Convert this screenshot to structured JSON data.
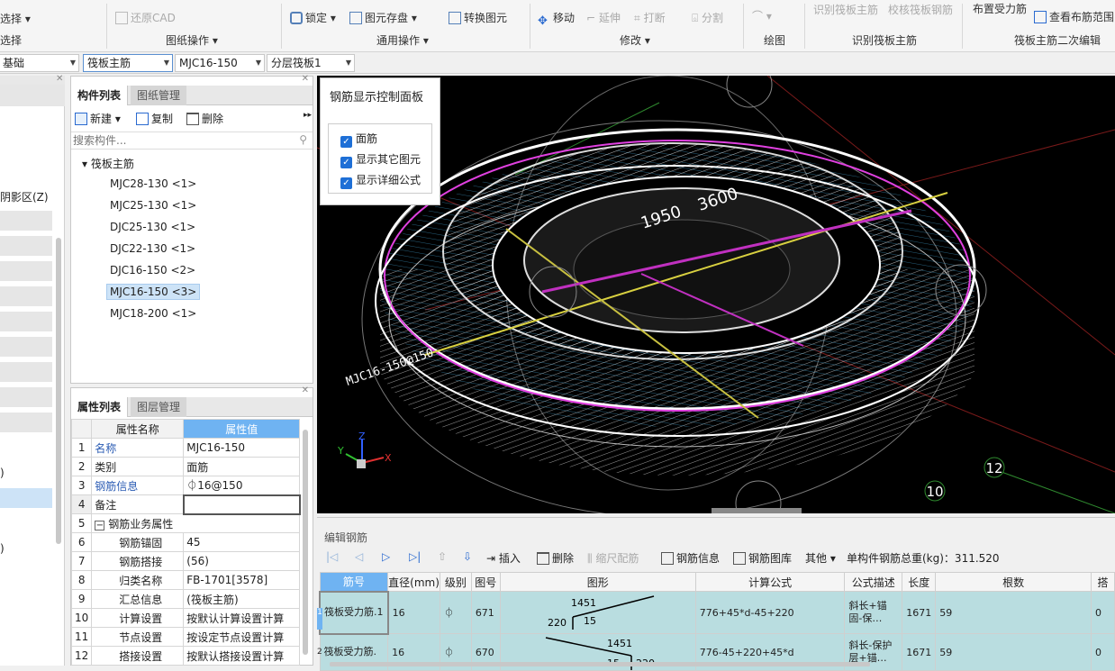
{
  "ribbon": {
    "row1": {
      "select": "选择",
      "restore_cad": "还原CAD",
      "lock": "锁定",
      "save_element": "图元存盘",
      "convert_element": "转换图元",
      "move": "移动",
      "extend": "延伸",
      "break": "打断",
      "split": "分割",
      "identify_main_rebar": "识别筏板主筋",
      "check_main_rebar": "校核筏板钢筋",
      "arrange_stress_rebar": "布置受力筋",
      "view_rebar_range": "查看布筋范围"
    },
    "groups": {
      "select": "选择",
      "drawing_ops": "图纸操作",
      "general_ops": "通用操作",
      "modify": "修改",
      "draw": "绘图",
      "identify": "识别筏板主筋",
      "secondary_edit": "筏板主筋二次编辑"
    }
  },
  "selbar": {
    "floor": "基础",
    "category": "筏板主筋",
    "component": "MJC16-150",
    "layer": "分层筏板1"
  },
  "left_pane": {
    "label_shadow": "阴影区(Z)",
    "label_a": ")",
    "label_b": ")"
  },
  "component_list": {
    "tab_active": "构件列表",
    "tab_inactive": "图纸管理",
    "new": "新建",
    "copy": "复制",
    "delete": "删除",
    "search_placeholder": "搜索构件...",
    "root": "筏板主筋",
    "items": [
      "MJC28-130 <1>",
      "MJC25-130 <1>",
      "DJC25-130 <1>",
      "DJC22-130 <1>",
      "DJC16-150 <2>",
      "MJC16-150 <3>",
      "MJC18-200 <1>"
    ]
  },
  "property_list": {
    "tab_active": "属性列表",
    "tab_inactive": "图层管理",
    "col_name": "属性名称",
    "col_value": "属性值",
    "rows": [
      {
        "n": "1",
        "name": "名称",
        "value": "MJC16-150"
      },
      {
        "n": "2",
        "name": "类别",
        "value": "面筋"
      },
      {
        "n": "3",
        "name": "钢筋信息",
        "value": "⏀16@150"
      },
      {
        "n": "4",
        "name": "备注",
        "value": ""
      },
      {
        "n": "5",
        "name": "钢筋业务属性",
        "value": ""
      },
      {
        "n": "6",
        "name": "钢筋锚固",
        "value": "45"
      },
      {
        "n": "7",
        "name": "钢筋搭接",
        "value": "(56)"
      },
      {
        "n": "8",
        "name": "归类名称",
        "value": "FB-1701[3578]"
      },
      {
        "n": "9",
        "name": "汇总信息",
        "value": "(筏板主筋)"
      },
      {
        "n": "10",
        "name": "计算设置",
        "value": "按默认计算设置计算"
      },
      {
        "n": "11",
        "name": "节点设置",
        "value": "按设定节点设置计算"
      },
      {
        "n": "12",
        "name": "搭接设置",
        "value": "按默认搭接设置计算"
      }
    ]
  },
  "control_panel": {
    "title": "钢筋显示控制面板",
    "options": [
      "面筋",
      "显示其它图元",
      "显示详细公式"
    ]
  },
  "viewport": {
    "dim_a": "1950",
    "dim_b": "3600",
    "rebar_label": "MJC16-150@150",
    "axis_12": "12",
    "axis_10": "10",
    "small_dim": "220"
  },
  "edit_rebar": {
    "title": "编辑钢筋",
    "insert": "插入",
    "delete": "删除",
    "scale_rebar": "缩尺配筋",
    "rebar_info": "钢筋信息",
    "rebar_library": "钢筋图库",
    "other": "其他",
    "total_weight": "单构件钢筋总重(kg)：311.520",
    "columns": [
      "筋号",
      "直径(mm)",
      "级别",
      "图号",
      "图形",
      "计算公式",
      "公式描述",
      "长度",
      "根数",
      "搭"
    ],
    "rows": [
      {
        "name": "筏板受力筋.1",
        "dia": "16",
        "grade": "⏀",
        "fig": "671",
        "shape_a": "1451",
        "shape_b": "220",
        "shape_c": "15",
        "formula": "776+45*d-45+220",
        "desc": "斜长+锚固-保…",
        "len": "1671",
        "count": "59",
        "lap": "0",
        "idx": "1"
      },
      {
        "name": "筏板受力筋.",
        "dia": "16",
        "grade": "⏀",
        "fig": "670",
        "shape_a": "1451",
        "shape_b": "15",
        "shape_c": "220",
        "formula": "776-45+220+45*d",
        "desc": "斜长-保护层+锚…",
        "len": "1671",
        "count": "59",
        "lap": "0",
        "idx": "2"
      }
    ]
  }
}
